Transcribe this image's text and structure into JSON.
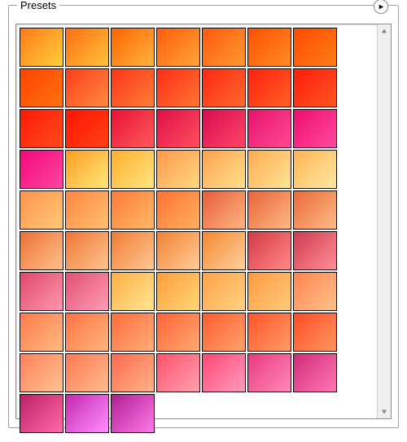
{
  "panel": {
    "title": "Presets"
  },
  "swatches": [
    {
      "from": "#ff7a18",
      "to": "#ffcf3a"
    },
    {
      "from": "#ff6e12",
      "to": "#ffc23a"
    },
    {
      "from": "#ff6500",
      "to": "#ffb23c"
    },
    {
      "from": "#ff5f0a",
      "to": "#ffa238"
    },
    {
      "from": "#ff5a10",
      "to": "#ff982e"
    },
    {
      "from": "#ff5000",
      "to": "#ff8c22"
    },
    {
      "from": "#ff4a00",
      "to": "#ff7e16"
    },
    {
      "from": "#ff4400",
      "to": "#ff720e"
    },
    {
      "from": "#ff3d1c",
      "to": "#ff8a3e"
    },
    {
      "from": "#ff3418",
      "to": "#ff7e38"
    },
    {
      "from": "#ff2e18",
      "to": "#ff7432"
    },
    {
      "from": "#ff2814",
      "to": "#ff6a2c"
    },
    {
      "from": "#ff2210",
      "to": "#ff6026"
    },
    {
      "from": "#ff1c0c",
      "to": "#ff5620"
    },
    {
      "from": "#ff1808",
      "to": "#ff4c1a"
    },
    {
      "from": "#ff1404",
      "to": "#ff4214"
    },
    {
      "from": "#e81038",
      "to": "#ff5a5a"
    },
    {
      "from": "#e00e44",
      "to": "#ff5060"
    },
    {
      "from": "#d80c52",
      "to": "#ff4566"
    },
    {
      "from": "#e6126c",
      "to": "#ff4a92"
    },
    {
      "from": "#ee0c72",
      "to": "#ff4a9c"
    },
    {
      "from": "#f2087a",
      "to": "#ff46a2"
    },
    {
      "from": "#ff9e20",
      "to": "#ffe77a"
    },
    {
      "from": "#ffae2e",
      "to": "#ffe680"
    },
    {
      "from": "#ff9a4a",
      "to": "#ffd780"
    },
    {
      "from": "#ffa24a",
      "to": "#ffe090"
    },
    {
      "from": "#ffac4e",
      "to": "#ffe49a"
    },
    {
      "from": "#ffb452",
      "to": "#ffe8a2"
    },
    {
      "from": "#ff944a",
      "to": "#ffc878"
    },
    {
      "from": "#ff8640",
      "to": "#ffc070"
    },
    {
      "from": "#ff7a38",
      "to": "#ffb868"
    },
    {
      "from": "#ff7230",
      "to": "#ffb060"
    },
    {
      "from": "#e65e3a",
      "to": "#ffb480"
    },
    {
      "from": "#e86438",
      "to": "#ffb884"
    },
    {
      "from": "#ea6a38",
      "to": "#ffbc88"
    },
    {
      "from": "#ec7036",
      "to": "#ffc08c"
    },
    {
      "from": "#ee7636",
      "to": "#ffc490"
    },
    {
      "from": "#f07c34",
      "to": "#ffc894"
    },
    {
      "from": "#f28234",
      "to": "#ffcc98"
    },
    {
      "from": "#f48832",
      "to": "#ffd09c"
    },
    {
      "from": "#d43844",
      "to": "#ff8a8a"
    },
    {
      "from": "#d03a52",
      "to": "#ff8f96"
    },
    {
      "from": "#e0486a",
      "to": "#ff96ac"
    },
    {
      "from": "#e25074",
      "to": "#ff9cb4"
    },
    {
      "from": "#ffae46",
      "to": "#ffe690"
    },
    {
      "from": "#ff9c3a",
      "to": "#ffd878"
    },
    {
      "from": "#ffa246",
      "to": "#ffd284"
    },
    {
      "from": "#ff9a40",
      "to": "#ffca7c"
    },
    {
      "from": "#ff8450",
      "to": "#ffc08a"
    },
    {
      "from": "#ff7c4a",
      "to": "#ffba84"
    },
    {
      "from": "#ff7444",
      "to": "#ffb47e"
    },
    {
      "from": "#ff6c3e",
      "to": "#ffae78"
    },
    {
      "from": "#ff6438",
      "to": "#ffa872"
    },
    {
      "from": "#ff5c32",
      "to": "#ffa26c"
    },
    {
      "from": "#ff542c",
      "to": "#ff9c66"
    },
    {
      "from": "#ff4c26",
      "to": "#ff9660"
    },
    {
      "from": "#ff8056",
      "to": "#ffc296"
    },
    {
      "from": "#ff7850",
      "to": "#ffbc90"
    },
    {
      "from": "#ff6a4c",
      "to": "#ffb28a"
    },
    {
      "from": "#ff5268",
      "to": "#ffa0b0"
    },
    {
      "from": "#ff4876",
      "to": "#ff9abc"
    },
    {
      "from": "#e83a80",
      "to": "#ff8ab6"
    },
    {
      "from": "#d22a7a",
      "to": "#ff78b4"
    },
    {
      "from": "#be2068",
      "to": "#ff6aa8"
    },
    {
      "from": "#c428b0",
      "to": "#ff8fff"
    },
    {
      "from": "#b01f94",
      "to": "#ff7ae6"
    }
  ],
  "icons": {
    "flyout": "flyout-arrow-icon",
    "scroll_up": "caret-up-icon",
    "scroll_down": "caret-down-icon"
  }
}
